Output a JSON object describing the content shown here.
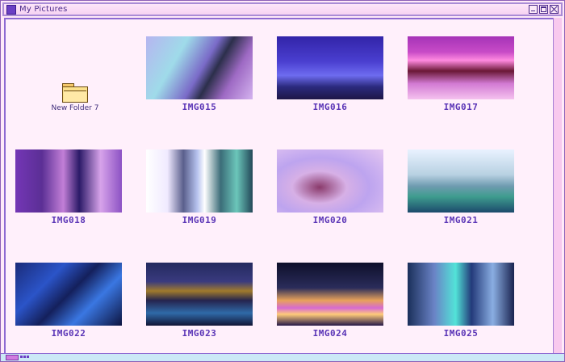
{
  "window": {
    "title": "My Pictures"
  },
  "folder": {
    "label": "New Folder 7",
    "icon": "folder-icon"
  },
  "images": [
    {
      "label": "IMG015"
    },
    {
      "label": "IMG016"
    },
    {
      "label": "IMG017"
    },
    {
      "label": "IMG018"
    },
    {
      "label": "IMG019"
    },
    {
      "label": "IMG020"
    },
    {
      "label": "IMG021"
    },
    {
      "label": "IMG022"
    },
    {
      "label": "IMG023"
    },
    {
      "label": "IMG024"
    },
    {
      "label": "IMG025"
    }
  ],
  "colors": {
    "accent": "#5a34b6",
    "titlebar_border": "#a98cd6",
    "background": "#fff0fb",
    "scrollbar": "#f8c9ee",
    "statusbar": "#cbe9f6"
  }
}
